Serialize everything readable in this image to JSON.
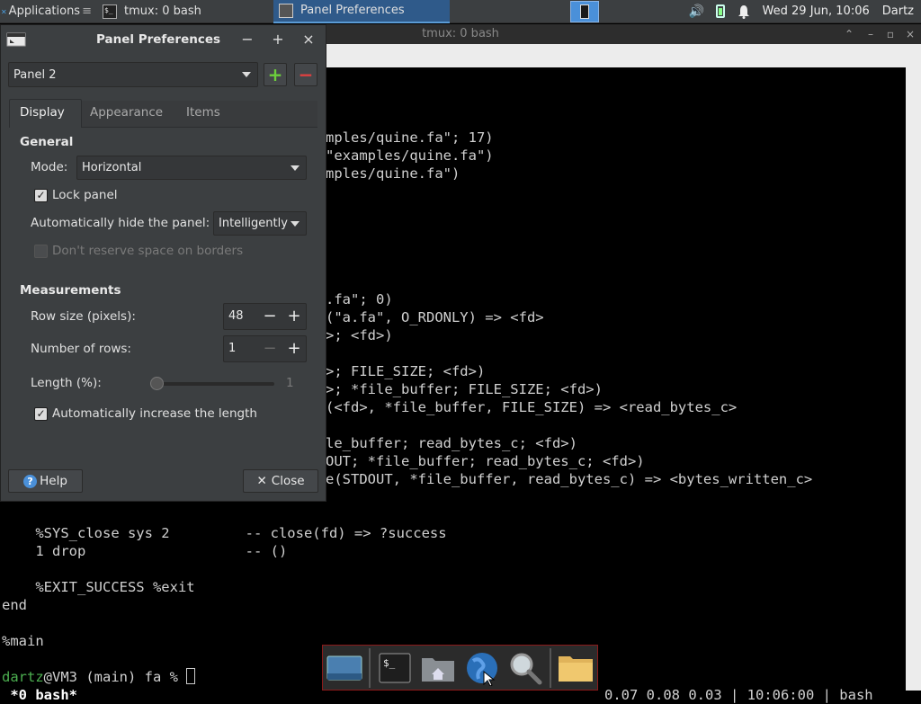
{
  "top_panel": {
    "apps_label": "Applications",
    "tasks": [
      {
        "label": "tmux: 0 bash"
      },
      {
        "label": "Panel Preferences"
      }
    ],
    "clock": "Wed 29 Jun, 10:06",
    "user": "Dartz"
  },
  "terminal": {
    "title": "tmux: 0 bash",
    "lines": [
      "mples/quine.fa\"; 17)",
      "\"examples/quine.fa\")",
      "mples/quine.fa\")",
      ".fa\"; 0)",
      "(\"a.fa\", O_RDONLY) => <fd>",
      ">; <fd>)",
      ">; FILE_SIZE; <fd>)",
      ">; *file_buffer; FILE_SIZE; <fd>)",
      "(<fd>, *file_buffer, FILE_SIZE) => <read_bytes_c>",
      "le_buffer; read_bytes_c; <fd>)",
      "OUT; *file_buffer; read_bytes_c; <fd>)",
      "e(STDOUT, *file_buffer, read_bytes_c) => <bytes_written_c>",
      "    %SYS_close sys 2         -- close(fd) => ?success",
      "    1 drop                   -- ()",
      "    %EXIT_SUCCESS %exit",
      "end",
      "%main"
    ],
    "prompt_user": "dartz",
    "prompt_rest": "@VM3 (main) fa % ",
    "status_left": " *0 bash*",
    "status_right": "0.07 0.08 0.03 | 10:06:00 | bash"
  },
  "dialog": {
    "title": "Panel Preferences",
    "panel_select": "Panel 2",
    "tabs": [
      "Display",
      "Appearance",
      "Items"
    ],
    "general_heading": "General",
    "mode_label": "Mode:",
    "mode_value": "Horizontal",
    "lock_panel_label": "Lock panel",
    "lock_panel_checked": true,
    "autohide_label": "Automatically hide the panel:",
    "autohide_value": "Intelligently",
    "reserve_space_label": "Don't reserve space on borders",
    "measurements_heading": "Measurements",
    "row_size_label": "Row size (pixels):",
    "row_size_value": "48",
    "num_rows_label": "Number of rows:",
    "num_rows_value": "1",
    "length_label": "Length (%):",
    "length_value": "1",
    "auto_length_label": "Automatically increase the length",
    "auto_length_checked": true,
    "help_label": "Help",
    "close_label": "Close"
  },
  "colors": {
    "prompt_user": "#4caf50",
    "add_green": "#6ccf3c",
    "remove_red": "#e04040",
    "dock_border": "#8b1a1a"
  }
}
